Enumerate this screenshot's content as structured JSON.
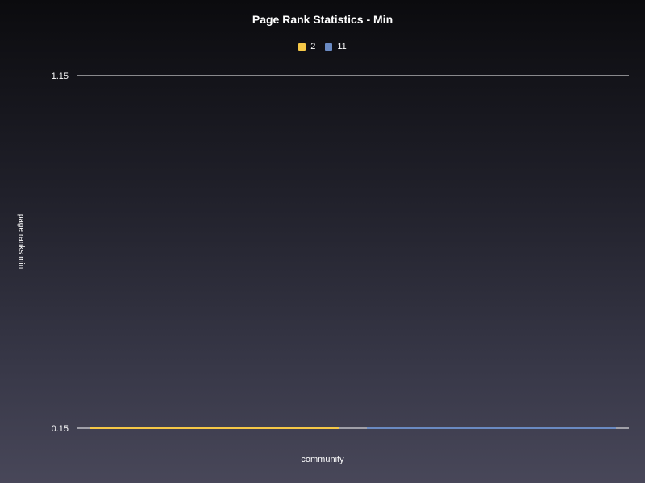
{
  "chart_data": {
    "type": "bar",
    "title": "Page Rank Statistics - Min",
    "xlabel": "community",
    "ylabel": "page ranks min",
    "categories": [
      ""
    ],
    "series": [
      {
        "name": "2",
        "values": [
          0.15
        ],
        "color": "#f5c847"
      },
      {
        "name": "11",
        "values": [
          0.15
        ],
        "color": "#6a8ac2"
      }
    ],
    "ylim": [
      0.15,
      1.15
    ],
    "yticks": [
      "0.15",
      "1.15"
    ],
    "grid": true,
    "legend_position": "top-center"
  }
}
